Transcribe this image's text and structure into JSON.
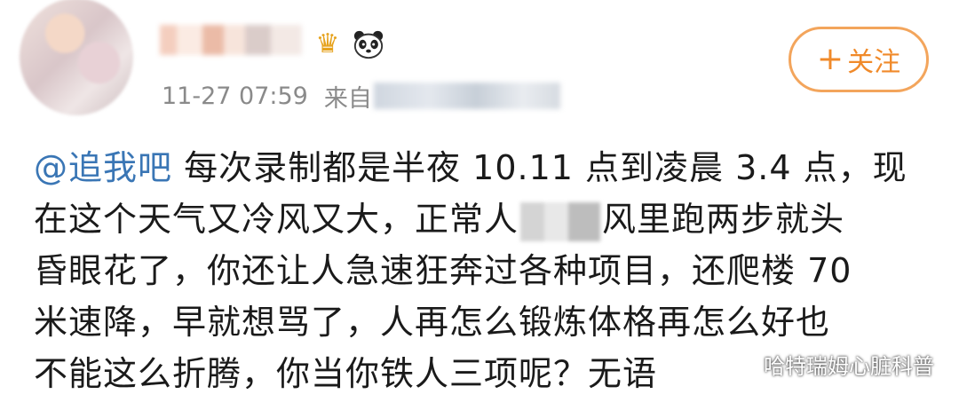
{
  "post": {
    "timestamp": "11-27 07:59",
    "source_prefix": "来自",
    "follow_label": "关注",
    "follow_plus": "+",
    "content_lines": [
      {
        "mention": "@追我吧",
        "text": " 每次录制都是半夜 10.11 点到凌晨 3.4 点，现"
      },
      {
        "before": "在这个天气又冷风又大，正常人",
        "after": "风里跑两步就头"
      },
      {
        "text": "昏眼花了，你还让人急速狂奔过各种项目，还爬楼 70"
      },
      {
        "text": "米速降，早就想骂了，人再怎么锻炼体格再怎么好也"
      },
      {
        "text": "不能这么折腾，你当你铁人三项呢？无语"
      }
    ]
  },
  "badges": {
    "crown_icon": "crown-icon",
    "panda_icon": "panda-icon"
  },
  "watermark": {
    "text": "哈特瑞姆心脏科普",
    "icon": "wechat-icon"
  },
  "colors": {
    "accent": "#f08a2a",
    "mention": "#3a76b5",
    "meta": "#8a8a8a"
  }
}
